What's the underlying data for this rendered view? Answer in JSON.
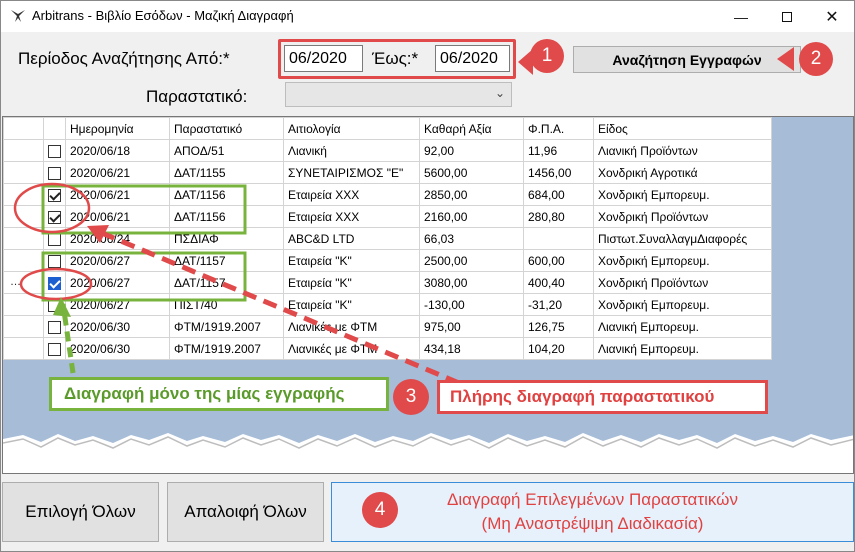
{
  "window": {
    "title": "Arbitrans - Βιβλίο Εσόδων - Μαζική Διαγραφή",
    "controls": [
      "minimize",
      "maximize",
      "close"
    ]
  },
  "search": {
    "period_label": "Περίοδος Αναζήτησης Από:*",
    "from_value": "06/2020",
    "to_label": "Έως:*",
    "to_value": "06/2020",
    "search_button": "Αναζήτηση Εγγραφών",
    "doc_label": "Παραστατικό:",
    "doc_value": ""
  },
  "grid": {
    "columns": [
      "",
      "Ημερομηνία",
      "Παραστατικό",
      "Αιτιολογία",
      "Καθαρή Αξία",
      "Φ.Π.Α.",
      "Είδος"
    ],
    "rows": [
      {
        "checked": false,
        "date": "2020/06/18",
        "doc": "ΑΠΟΔ/51",
        "reason": "Λιανική",
        "net": "92,00",
        "vat": "11,96",
        "type": "Λιανική Προϊόντων"
      },
      {
        "checked": false,
        "date": "2020/06/21",
        "doc": "ΔΑΤ/1155",
        "reason": "ΣΥΝΕΤΑΙΡΙΣΜΟΣ \"Ε\"",
        "net": "5600,00",
        "vat": "1456,00",
        "type": "Χονδρική Αγροτικά"
      },
      {
        "checked": true,
        "date": "2020/06/21",
        "doc": "ΔΑΤ/1156",
        "reason": "Εταιρεία ΧΧΧ",
        "net": "2850,00",
        "vat": "684,00",
        "type": "Χονδρική Εμπορευμ."
      },
      {
        "checked": true,
        "date": "2020/06/21",
        "doc": "ΔΑΤ/1156",
        "reason": "Εταιρεία ΧΧΧ",
        "net": "2160,00",
        "vat": "280,80",
        "type": "Χονδρική Προϊόντων"
      },
      {
        "checked": false,
        "date": "2020/06/24",
        "doc": "ΠΣΔΙΑΦ",
        "reason": "ABC&D LTD",
        "net": "66,03",
        "vat": "",
        "type": "Πιστωτ.ΣυναλλαγμΔιαφορές"
      },
      {
        "checked": false,
        "date": "2020/06/27",
        "doc": "ΔΑΤ/1157",
        "reason": "Εταιρεία \"Κ\"",
        "net": "2500,00",
        "vat": "600,00",
        "type": "Χονδρική Εμπορευμ."
      },
      {
        "checked": true,
        "active": true,
        "date": "2020/06/27",
        "doc": "ΔΑΤ/1157",
        "reason": "Εταιρεία \"Κ\"",
        "net": "3080,00",
        "vat": "400,40",
        "type": "Χονδρική Προϊόντων"
      },
      {
        "checked": false,
        "date": "2020/06/27",
        "doc": "ΠΙΣΤ/40",
        "reason": "Εταιρεία \"Κ\"",
        "net": "-130,00",
        "vat": "-31,20",
        "type": "Χονδρική Εμπορευμ."
      },
      {
        "checked": false,
        "date": "2020/06/30",
        "doc": "ΦΤΜ/1919.2007",
        "reason": "Λιανικές με ΦΤΜ",
        "net": "975,00",
        "vat": "126,75",
        "type": "Λιανική Εμπορευμ."
      },
      {
        "checked": false,
        "date": "2020/06/30",
        "doc": "ΦΤΜ/1919.2007",
        "reason": "Λιανικές με ΦΤΜ",
        "net": "434,18",
        "vat": "104,20",
        "type": "Λιανική Εμπορευμ."
      }
    ]
  },
  "buttons": {
    "select_all": "Επιλογή Όλων",
    "deselect_all": "Απαλοιφή Όλων",
    "delete_line1": "Διαγραφή Επιλεγμένων Παραστατικών",
    "delete_line2": "(Μη Αναστρέψιμη Διαδικασία)"
  },
  "annotations": {
    "badge1": "1",
    "badge2": "2",
    "badge3": "3",
    "badge4": "4",
    "single_delete": "Διαγραφή μόνο της μίας εγγραφής",
    "full_delete": "Πλήρης διαγραφή παραστατικού"
  },
  "colors": {
    "annotation_red": "#e04a4a",
    "annotation_green": "#78b33d",
    "grid_background": "#a6bcd7",
    "delete_text": "#e04141"
  }
}
